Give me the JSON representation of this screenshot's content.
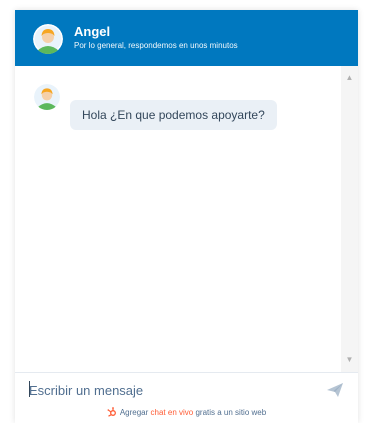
{
  "header": {
    "agent_name": "Angel",
    "status": "Por lo general, respondemos en unos minutos",
    "avatar_icon": "agent-avatar-icon"
  },
  "messages": [
    {
      "from": "agent",
      "text": "Hola ¿En que podemos apoyarte?"
    }
  ],
  "composer": {
    "placeholder": "Escribir un mensaje",
    "send_icon": "send-paper-plane-icon"
  },
  "branding": {
    "prefix": "Agregar",
    "link": "chat en vivo",
    "suffix": "gratis a un sitio web",
    "icon": "hubspot-sprocket-icon"
  },
  "colors": {
    "header_bg": "#0078bf",
    "bubble_bg": "#eaf0f6",
    "brand_link": "#ff5c35",
    "avatar_green": "#5cb85c",
    "avatar_orange": "#f6a623"
  }
}
